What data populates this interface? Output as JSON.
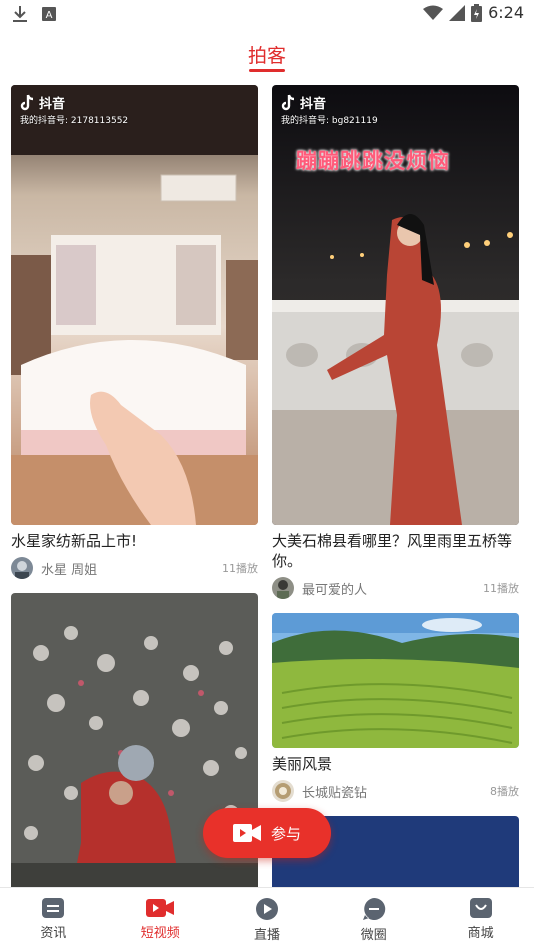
{
  "status_bar": {
    "time": "6:24"
  },
  "header": {
    "title": "拍客"
  },
  "feed": {
    "left": [
      {
        "title": "水星家纺新品上市!",
        "author": "水星 周姐",
        "plays": "11播放",
        "overlay": {
          "app": "抖音",
          "id": "我的抖音号: 2178113552"
        }
      },
      {
        "title": "",
        "author": "",
        "plays": ""
      }
    ],
    "right": [
      {
        "title": "大美石棉县看哪里？风里雨里五桥等你。",
        "author": "最可爱的人",
        "plays": "11播放",
        "overlay": {
          "app": "抖音",
          "id": "我的抖音号: bg821119",
          "caption": "蹦蹦跳跳没烦恼"
        }
      },
      {
        "title": "美丽风景",
        "author": "长城贴瓷钻",
        "plays": "8播放"
      }
    ]
  },
  "join_button": {
    "label": "参与"
  },
  "tabbar": {
    "items": [
      {
        "label": "资讯",
        "icon": "news-icon"
      },
      {
        "label": "短视频",
        "icon": "video-icon",
        "active": true
      },
      {
        "label": "直播",
        "icon": "live-icon"
      },
      {
        "label": "微圈",
        "icon": "circle-icon"
      },
      {
        "label": "商城",
        "icon": "shop-icon"
      }
    ]
  },
  "colors": {
    "accent": "#e02d2d",
    "button": "#e8312a"
  }
}
